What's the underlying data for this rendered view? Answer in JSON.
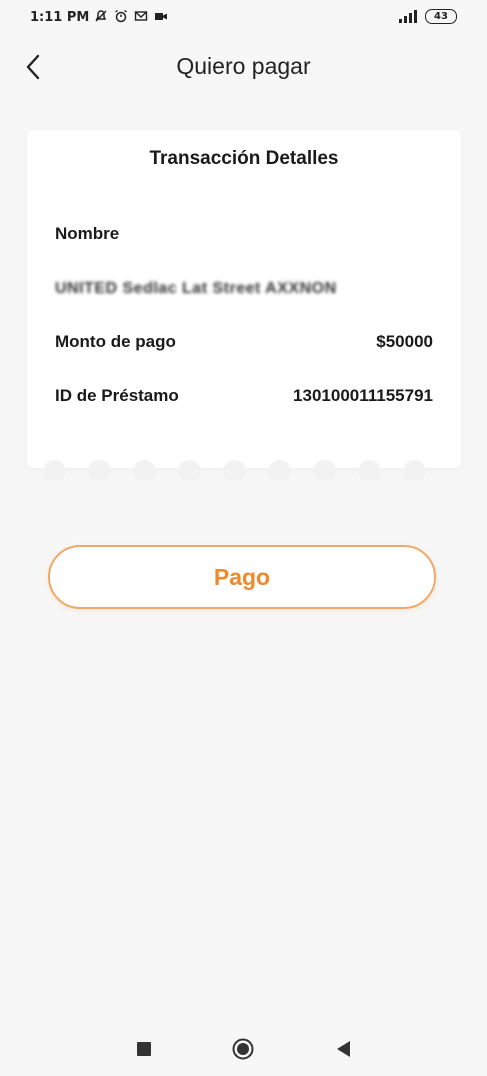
{
  "status_bar": {
    "time": "1:11 PM",
    "battery": "43",
    "left_icons": [
      "notification-off-icon",
      "alarm-icon",
      "mail-icon",
      "video-icon"
    ],
    "right_icons": [
      "signal-icon",
      "battery-icon"
    ]
  },
  "header": {
    "title": "Quiero pagar",
    "back_icon": "chevron-left-icon"
  },
  "card": {
    "title": "Transacción Detalles",
    "name_label": "Nombre",
    "name_value": "UNITED Sedlac Lat Street AXXNON",
    "amount_label": "Monto de pago",
    "amount_value": "$50000",
    "loan_id_label": "ID de Préstamo",
    "loan_id_value": "130100011155791"
  },
  "pay_button": {
    "label": "Pago"
  },
  "colors": {
    "accent": "#ee8a2c",
    "accent_border": "#f0a866",
    "background": "#f7f7f7",
    "card": "#ffffff"
  },
  "navbar": {
    "icons": [
      "recent-apps-icon",
      "home-icon",
      "back-icon"
    ]
  }
}
